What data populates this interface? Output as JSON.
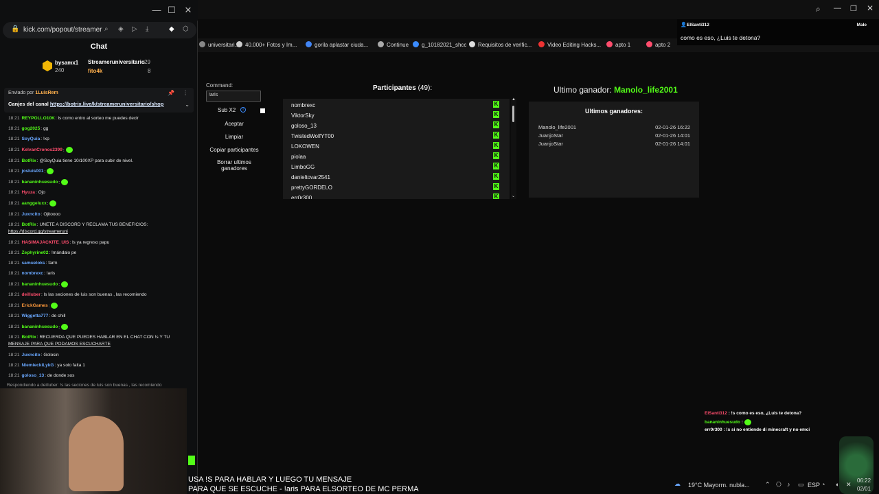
{
  "popout": {
    "url": "kick.com/popout/streamer",
    "chat_title": "Chat",
    "leaderboard": [
      {
        "name": "bysamx1",
        "value": "240"
      },
      {
        "name": "Streameruniversitario",
        "value": "29"
      },
      {
        "name": "fito4k",
        "value": "8"
      }
    ],
    "pinned": {
      "header": "Enviado por",
      "pinned_by": "1LuisRem",
      "text": "Canjes del canal",
      "link": "https://botrix.live/k/streameruniversitario/shop"
    },
    "messages": [
      {
        "time": "18:21",
        "user": "REYPOLLO10K",
        "color": "#53fc18",
        "text": "ls como entro al sorteo me puedes decir"
      },
      {
        "time": "18:21",
        "user": "gog2025",
        "color": "#53fc18",
        "text": "gg"
      },
      {
        "time": "18:21",
        "user": "SoyQuia",
        "color": "#6aa8ff",
        "text": "!xp"
      },
      {
        "time": "18:21",
        "user": "KelvanCronos2399",
        "color": "#ff4d6d",
        "text": ""
      },
      {
        "time": "18:21",
        "user": "BotRix",
        "color": "#53fc18",
        "text": "@SoyQuia tiene 10/100XP para subir de nivel."
      },
      {
        "time": "18:21",
        "user": "josluis001",
        "color": "#6aa8ff",
        "text": ""
      },
      {
        "time": "18:21",
        "user": "bananinhuesudo",
        "color": "#53fc18",
        "text": ""
      },
      {
        "time": "18:21",
        "user": "Hyuza",
        "color": "#ff4d6d",
        "text": "Ojo"
      },
      {
        "time": "18:21",
        "user": "aanggeluxx",
        "color": "#53fc18",
        "text": ""
      },
      {
        "time": "18:21",
        "user": "Juxncito",
        "color": "#6aa8ff",
        "text": "Ojitoooo"
      },
      {
        "time": "18:21",
        "user": "BotRix",
        "color": "#53fc18",
        "text": "UNETE A DISCORD Y RECLAMA TUS BENEFICIOS:"
      },
      {
        "time": "",
        "user": "",
        "color": "#ffffff",
        "text": "https://discord.gg/streameruni"
      },
      {
        "time": "18:21",
        "user": "HASIMAJACKITE_UIS",
        "color": "#ff4d6d",
        "text": "ls ya regreso papu"
      },
      {
        "time": "18:21",
        "user": "Zephyrine02",
        "color": "#53fc18",
        "text": "!mándalo pe"
      },
      {
        "time": "18:21",
        "user": "samueloks",
        "color": "#6aa8ff",
        "text": "farm"
      },
      {
        "time": "18:21",
        "user": "nombrexc",
        "color": "#6aa8ff",
        "text": "!aris"
      },
      {
        "time": "18:21",
        "user": "bananinhuesudo",
        "color": "#53fc18",
        "text": ""
      },
      {
        "time": "18:21",
        "user": "deilluber",
        "color": "#ff4d6d",
        "text": "ls las seciones de luis son buenas , las recomiendo"
      },
      {
        "time": "18:21",
        "user": "ErickGames",
        "color": "#ff9a3c",
        "text": ""
      },
      {
        "time": "18:21",
        "user": "Wiggetta777",
        "color": "#6aa8ff",
        "text": "de chill"
      },
      {
        "time": "18:21",
        "user": "bananinhuesudo",
        "color": "#53fc18",
        "text": ""
      },
      {
        "time": "18:21",
        "user": "BotRix",
        "color": "#53fc18",
        "text": "RECUERDA QUE PUEDES HABLAR EN EL CHAT CON !s Y TU"
      },
      {
        "time": "",
        "user": "",
        "color": "#ffffff",
        "text": "MENSAJE PARA QUE PODAMOS ESCUCHARTE"
      },
      {
        "time": "18:21",
        "user": "Juxncito",
        "color": "#6aa8ff",
        "text": "Golosin"
      },
      {
        "time": "18:21",
        "user": "NiemieckiLykG",
        "color": "#6aa8ff",
        "text": "ya solo falta 1"
      },
      {
        "time": "18:21",
        "user": "goloso_13",
        "color": "#6aa8ff",
        "text": "de donde sos"
      }
    ],
    "reply_bar": "Respondiendo a deilluber: !s las seciones de luis son buenas , las recomiendo"
  },
  "bookmarks": [
    "universitari...",
    "40.000+ Fotos y Im...",
    "gorila aplastar ciuda...",
    "Continue",
    "g_10182021_shcc",
    "Requisitos de verific...",
    "Video Editing Hacks...",
    "apto 1",
    "apto 2"
  ],
  "raffle": {
    "command_label": "Command:",
    "command_value": "!aris",
    "subx2_label": "Sub X2",
    "buttons": [
      "Aceptar",
      "Limpiar",
      "Copiar participantes",
      "Borrar ultimos ganadores"
    ],
    "participants_label": "Participantes",
    "participants_count": "(49):",
    "participants": [
      "nombrexc",
      "ViktorSky",
      "goloso_13",
      "TwistedWolfYT00",
      "LOKOWEN",
      "piolaa",
      "LimboGG",
      "danieltovar2541",
      "prettyGORDELO",
      "err0r300"
    ],
    "winner_label": "Ultimo ganador:",
    "winner_name": "Manolo_life2001",
    "winners_title": "Ultimos ganadores:",
    "winners": [
      {
        "name": "Manolo_life2001",
        "date": "02-01-26 16:22"
      },
      {
        "name": "JuanjoStar",
        "date": "02-01-26 14:01"
      },
      {
        "name": "JuanjoStar",
        "date": "02-01-26 14:01"
      }
    ]
  },
  "notification": {
    "user": "ElSanti312",
    "message": "como es eso, ¿Luis te detona?",
    "right": "Male"
  },
  "overlay_chat": [
    {
      "user": "ElSanti312",
      "color": "#ff4d6d",
      "text": "!s como es eso, ¿Luis te detona?"
    },
    {
      "user": "bananinhuesudo",
      "color": "#53fc18",
      "text": ""
    },
    {
      "user": "err0r300",
      "color": "#ffffff",
      "text": "!s si no entiende di minecraft y no emci"
    }
  ],
  "subtitle": [
    "USA !S PARA HABLAR Y LUEGO TU MENSAJE",
    "PARA QUE SE ESCUCHE - !aris PARA ELSORTEO DE MC PERMA"
  ],
  "taskbar": {
    "weather": "19°C  Mayorm. nubla...",
    "lang": "ESP",
    "time": "06:22",
    "date": "02/01"
  }
}
